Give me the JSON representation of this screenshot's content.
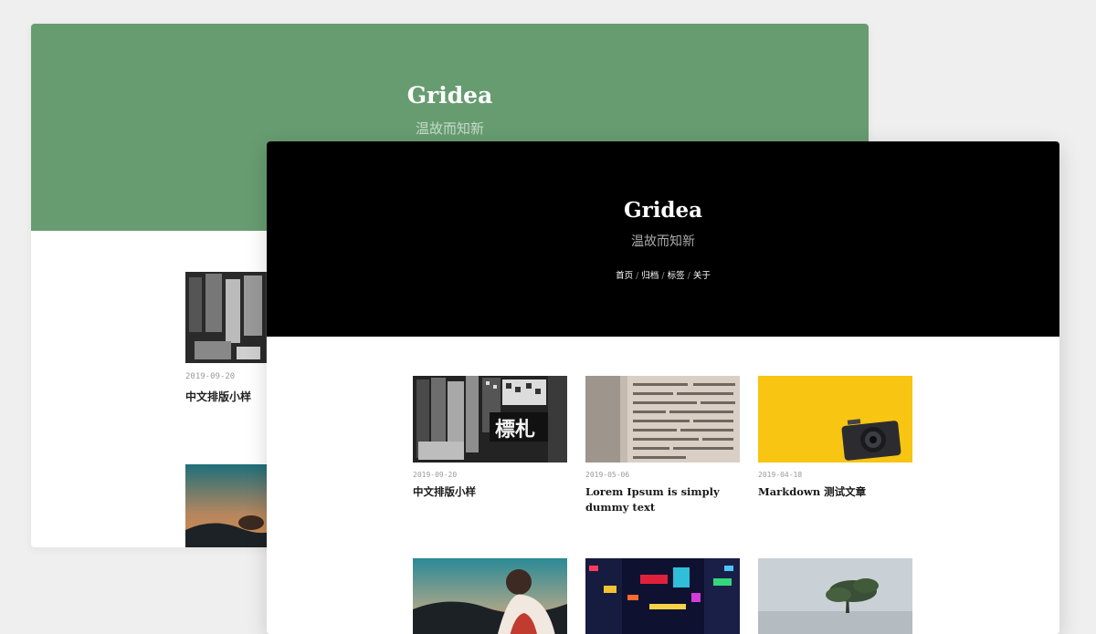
{
  "back_window": {
    "site_title": "Gridea",
    "site_subtitle": "温故而知新",
    "header_color": "#679c70",
    "posts": [
      {
        "date": "2019-09-20",
        "title": "中文排版小样",
        "image": "street-signs-bw"
      }
    ],
    "second_image": "sunset-portrait"
  },
  "front_window": {
    "site_title": "Gridea",
    "site_subtitle": "温故而知新",
    "header_color": "#000000",
    "nav": [
      "首页",
      "归档",
      "标签",
      "关于"
    ],
    "posts": [
      {
        "date": "2019-09-20",
        "title": "中文排版小样",
        "image": "street-signs-bw"
      },
      {
        "date": "2019-05-06",
        "title": "Lorem Ipsum is simply dummy text",
        "image": "dictionary-page"
      },
      {
        "date": "2019-04-18",
        "title": "Markdown 测试文章",
        "image": "camera-on-yellow"
      }
    ],
    "more_images": [
      "sunset-portrait",
      "neon-city-night",
      "foggy-tree"
    ]
  }
}
